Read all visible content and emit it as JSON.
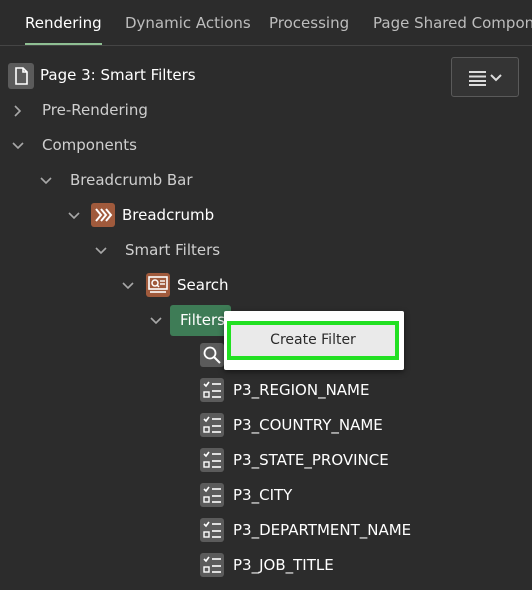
{
  "tabs": [
    "Rendering",
    "Dynamic Actions",
    "Processing",
    "Page Shared Componer"
  ],
  "page_title": "Page 3: Smart Filters",
  "tree": {
    "pre_rendering": "Pre-Rendering",
    "components": "Components",
    "breadcrumb_bar": "Breadcrumb Bar",
    "breadcrumb": "Breadcrumb",
    "smart_filters": "Smart Filters",
    "search": "Search",
    "filters": "Filters",
    "items": [
      "P3_REGION_NAME",
      "P3_COUNTRY_NAME",
      "P3_STATE_PROVINCE",
      "P3_CITY",
      "P3_DEPARTMENT_NAME",
      "P3_JOB_TITLE"
    ]
  },
  "context_menu": {
    "create_filter": "Create Filter"
  },
  "colors": {
    "accent_tab": "#8fbf93",
    "filters_highlight": "#3e7c56",
    "popup_focus": "#22e022"
  }
}
